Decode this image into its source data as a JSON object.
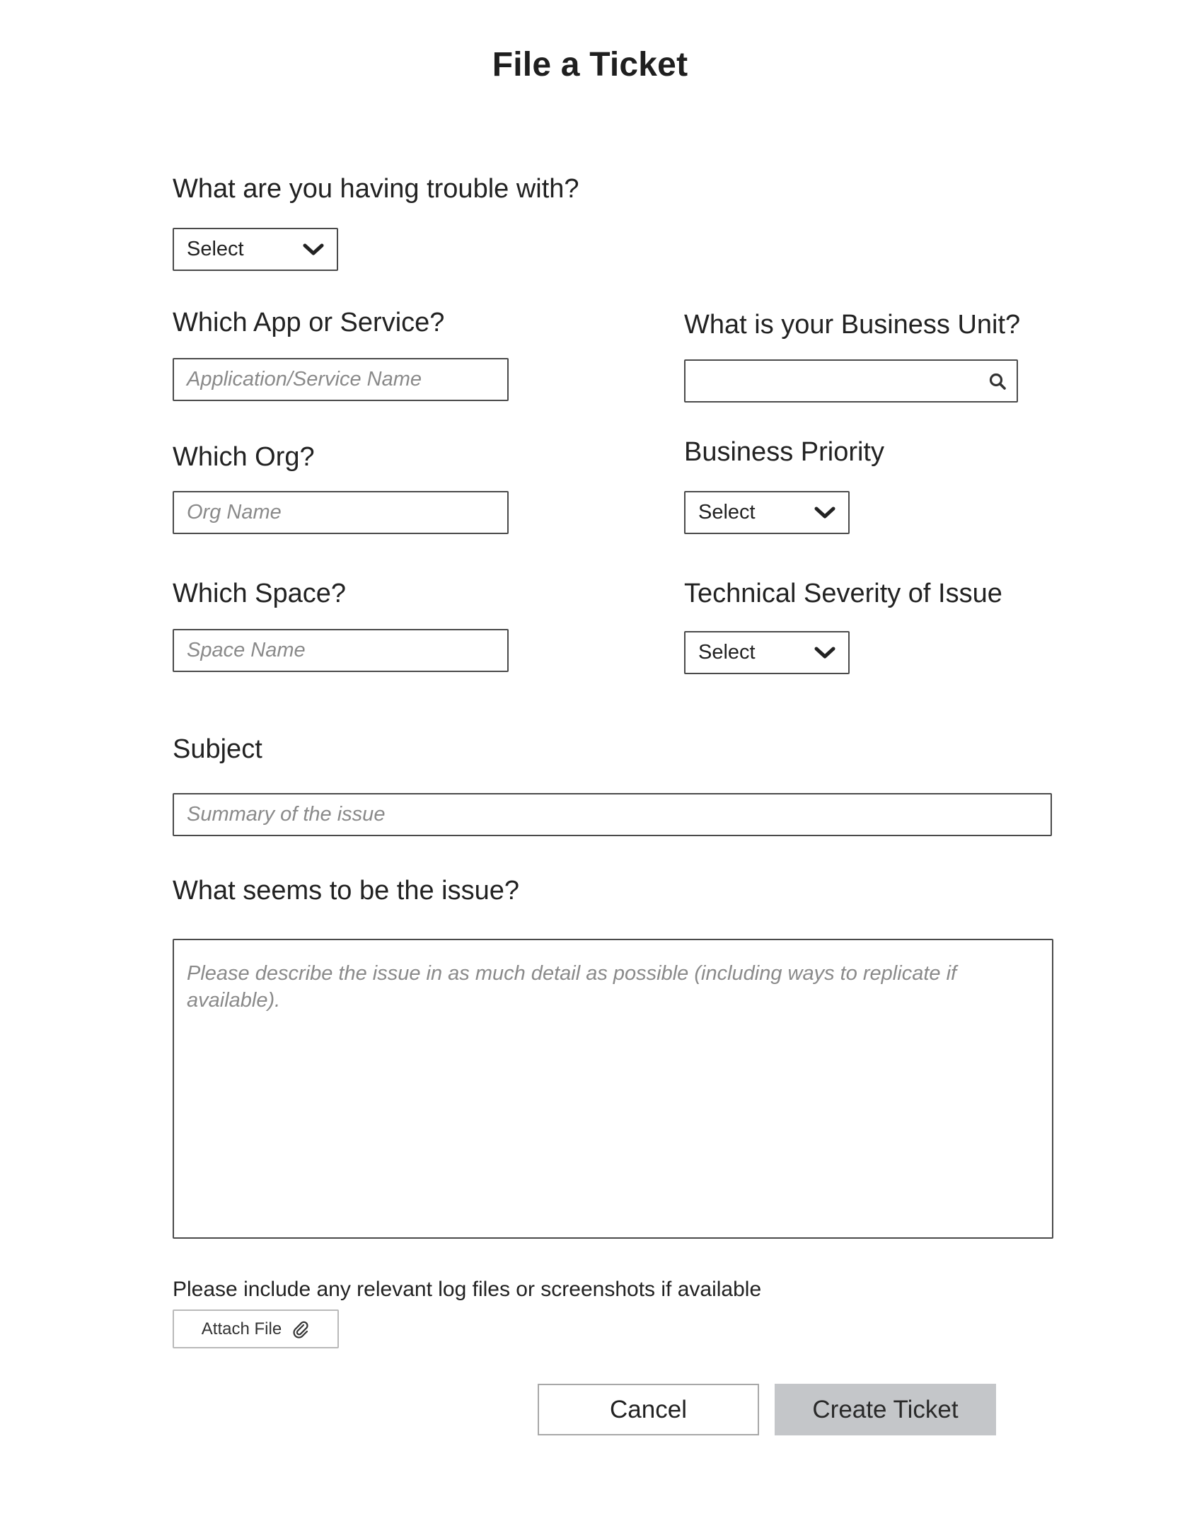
{
  "page": {
    "title": "File a Ticket"
  },
  "form": {
    "trouble": {
      "label": "What are you having trouble with?",
      "value": "Select"
    },
    "app_service": {
      "label": "Which App or Service?",
      "placeholder": "Application/Service Name"
    },
    "business_unit": {
      "label": "What is your Business Unit?",
      "value": ""
    },
    "org": {
      "label": "Which Org?",
      "placeholder": "Org Name"
    },
    "business_priority": {
      "label": "Business Priority",
      "value": "Select"
    },
    "space": {
      "label": "Which Space?",
      "placeholder": "Space Name"
    },
    "technical_severity": {
      "label": "Technical Severity of Issue",
      "value": "Select"
    },
    "subject": {
      "label": "Subject",
      "placeholder": "Summary of the issue"
    },
    "issue": {
      "label": "What seems to be the issue?",
      "placeholder": "Please describe the issue in as much detail as possible (including ways to replicate if available)."
    },
    "attachments": {
      "help_text": "Please include any relevant log files or screenshots if available",
      "button_label": "Attach File"
    }
  },
  "actions": {
    "cancel_label": "Cancel",
    "create_label": "Create Ticket"
  },
  "icons": {
    "dropdown": "chevron-down-icon",
    "search": "search-icon",
    "attach": "paperclip-icon"
  },
  "colors": {
    "border": "#4a4a4a",
    "placeholder": "#8a8a8a",
    "primary_button_bg": "#c4c6c9",
    "text": "#222222"
  }
}
